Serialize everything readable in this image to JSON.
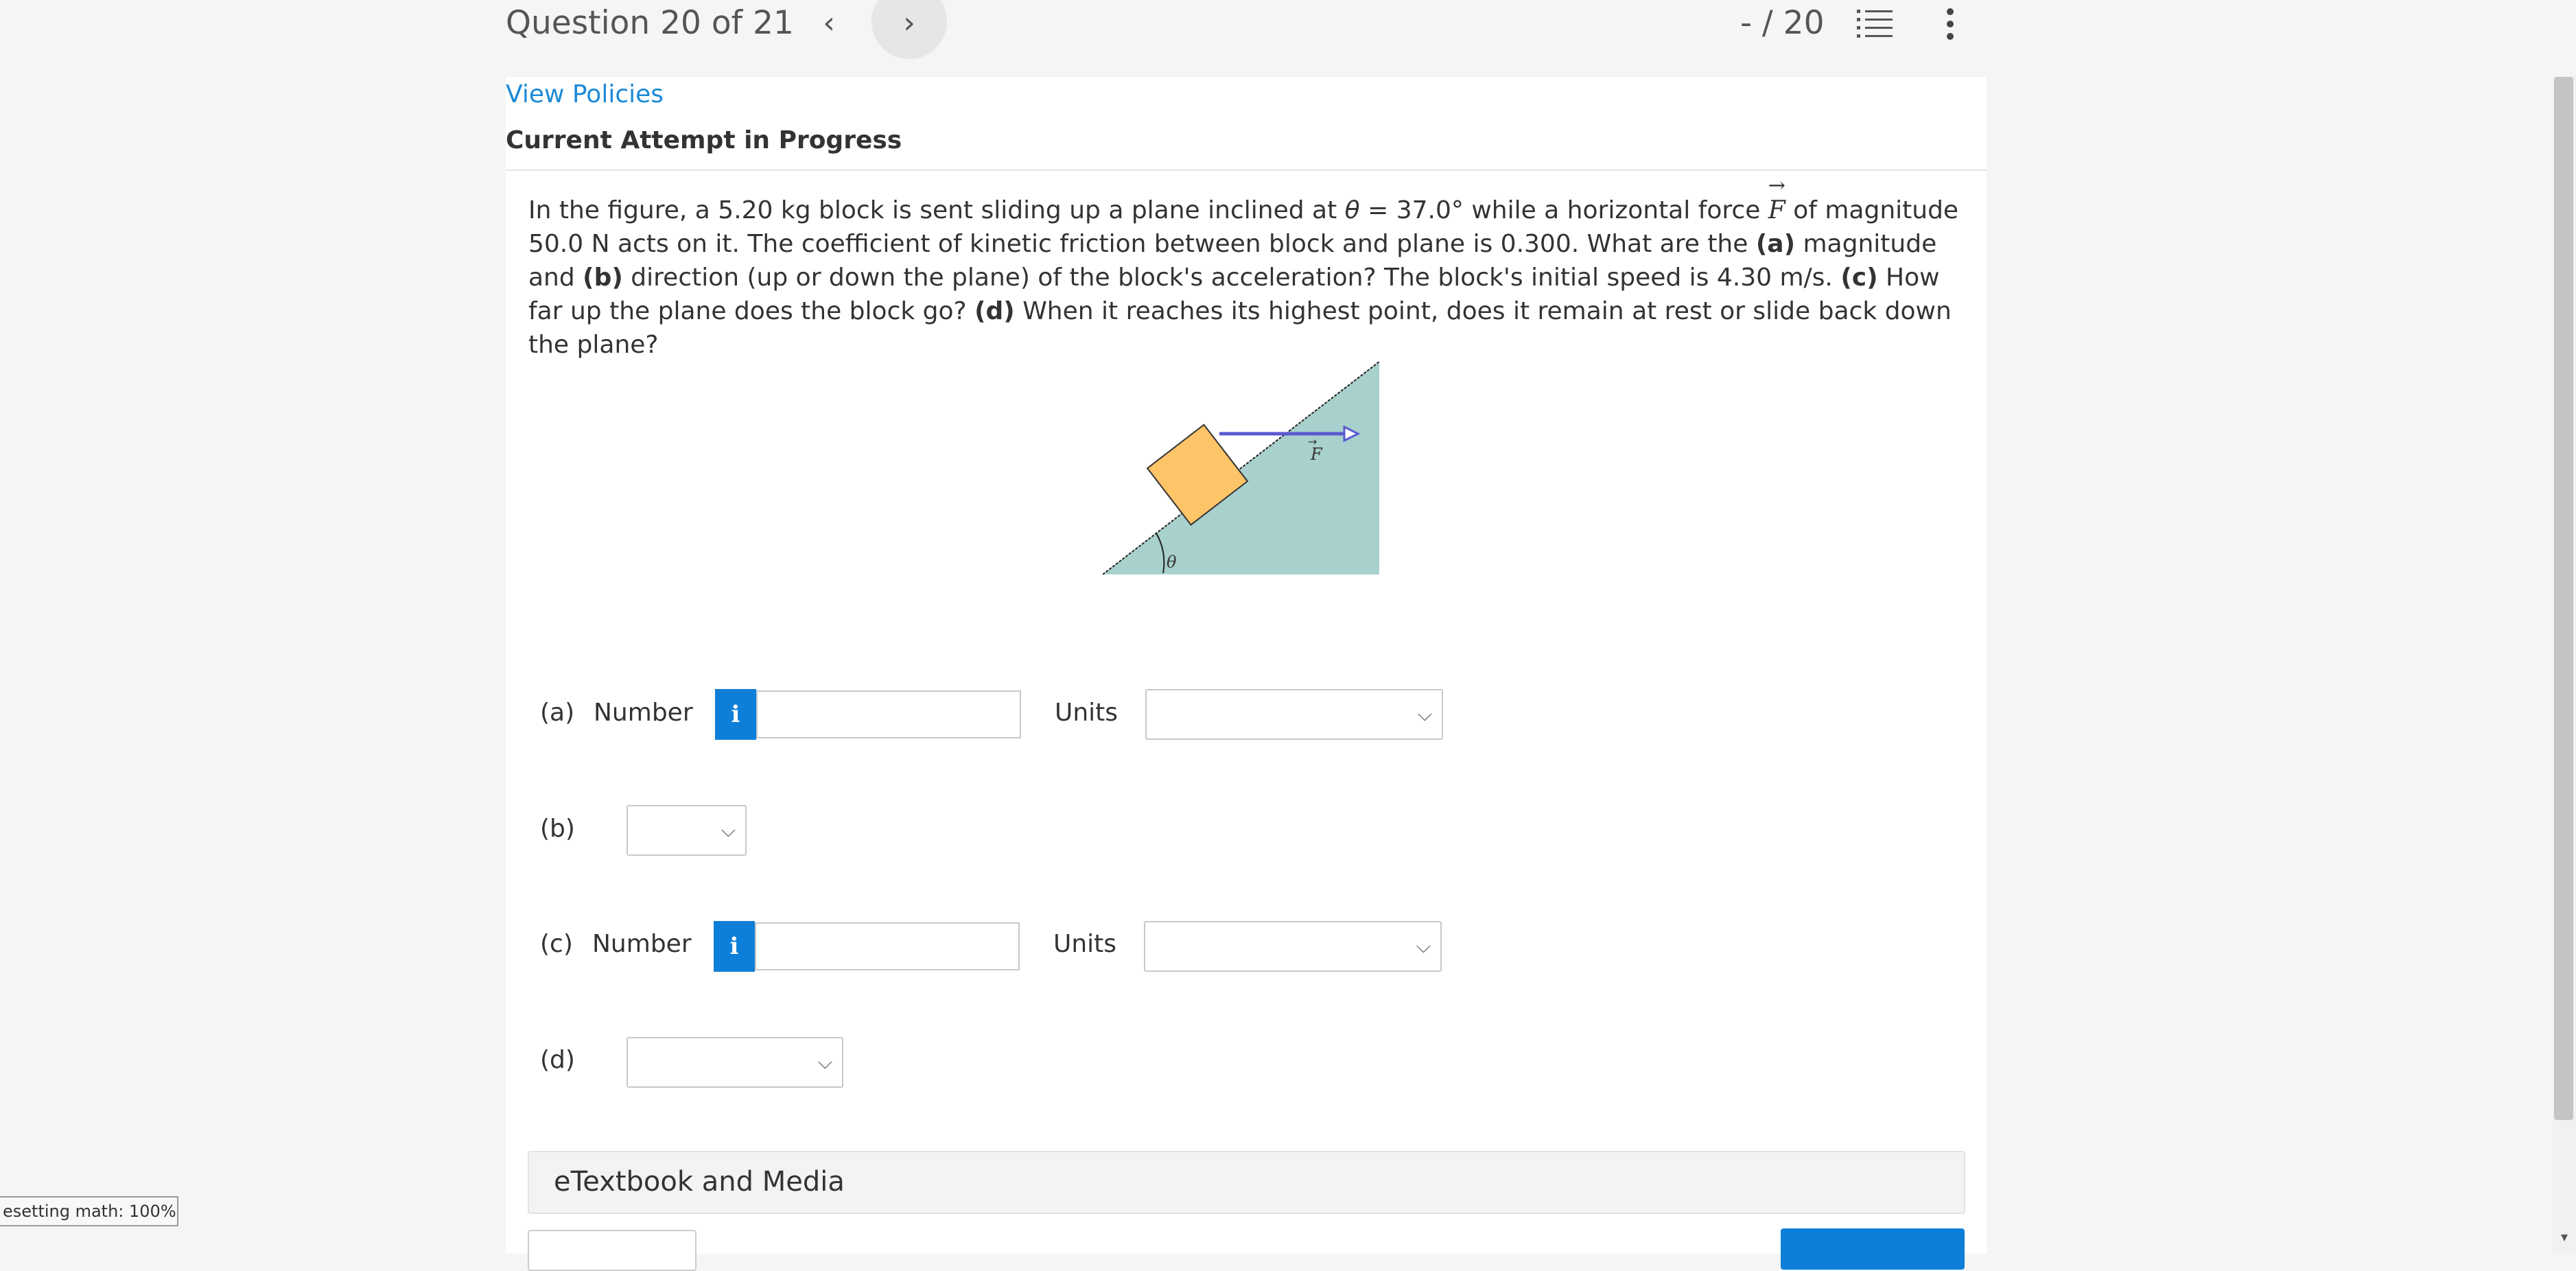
{
  "header": {
    "question_counter": "Question 20 of 21",
    "prev_icon": "chevron-left-icon",
    "next_icon": "chevron-right-icon",
    "score": "- / 20",
    "list_icon": "list-icon",
    "more_icon": "more-vertical-icon"
  },
  "links": {
    "view_policies": "View Policies"
  },
  "section": {
    "attempt_status": "Current Attempt in Progress"
  },
  "question": {
    "p1": "In the figure, a 5.20 kg block is sent sliding up a plane inclined at ",
    "theta": "θ",
    "p2": " = 37.0° while a horizontal force ",
    "force_symbol": "F",
    "p3": " of magnitude 50.0 N acts on it. The coefficient of kinetic friction between block and plane is 0.300. What are the ",
    "part_a": "(a)",
    "p4": " magnitude and ",
    "part_b": "(b)",
    "p5": " direction (up or down the plane) of the block's acceleration? The block's initial speed is 4.30 m/s. ",
    "part_c": "(c)",
    "p6": " How far up the plane does the block go? ",
    "part_d": "(d)",
    "p7": " When it reaches its highest point, does it remain at rest or slide back down the plane?"
  },
  "figure": {
    "force_label": "F",
    "angle_label": "θ",
    "colors": {
      "plane": "#a8d0cc",
      "block": "#fec468",
      "arrow": "#5a5ad0"
    }
  },
  "answers": {
    "a": {
      "label": "(a)",
      "field_label": "Number",
      "info_icon": "i",
      "value": "",
      "units_label": "Units",
      "units_selected": ""
    },
    "b": {
      "label": "(b)",
      "selected": ""
    },
    "c": {
      "label": "(c)",
      "field_label": "Number",
      "info_icon": "i",
      "value": "",
      "units_label": "Units",
      "units_selected": ""
    },
    "d": {
      "label": "(d)",
      "selected": ""
    }
  },
  "resources": {
    "etextbook_label": "eTextbook and Media"
  },
  "status_bar": {
    "text": "esetting math: 100%"
  },
  "colors": {
    "link": "#1c8ad6",
    "accent": "#0e7fd8"
  }
}
